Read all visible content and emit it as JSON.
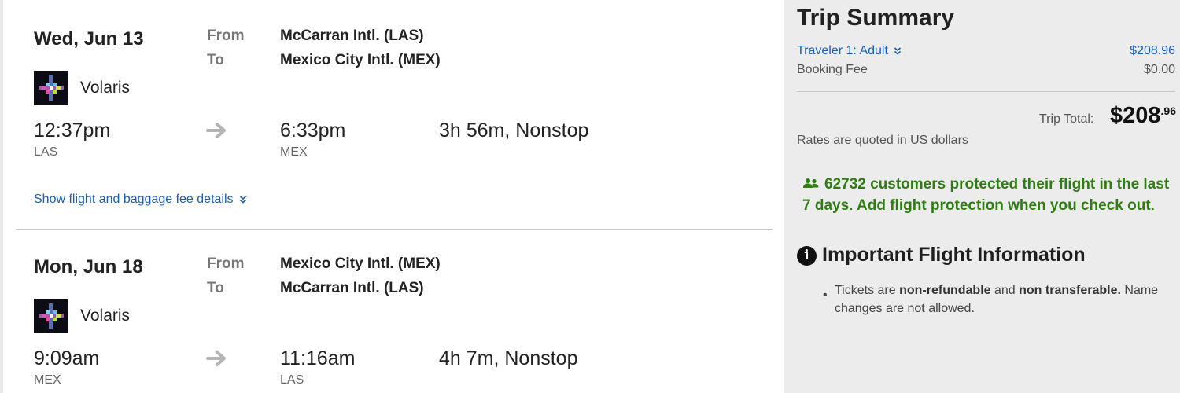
{
  "flights": [
    {
      "date": "Wed, Jun 13",
      "from_label": "From",
      "to_label": "To",
      "from_airport": "McCarran Intl. (LAS)",
      "to_airport": "Mexico City Intl. (MEX)",
      "airline": "Volaris",
      "depart_time": "12:37pm",
      "depart_code": "LAS",
      "arrive_time": "6:33pm",
      "arrive_code": "MEX",
      "duration": "3h 56m, Nonstop",
      "details_link": "Show flight and baggage fee details"
    },
    {
      "date": "Mon, Jun 18",
      "from_label": "From",
      "to_label": "To",
      "from_airport": "Mexico City Intl. (MEX)",
      "to_airport": "McCarran Intl. (LAS)",
      "airline": "Volaris",
      "depart_time": "9:09am",
      "depart_code": "MEX",
      "arrive_time": "11:16am",
      "arrive_code": "LAS",
      "duration": "4h 7m, Nonstop"
    }
  ],
  "summary": {
    "title": "Trip Summary",
    "traveler_label": "Traveler 1: Adult",
    "traveler_price": "$208.96",
    "fee_label": "Booking Fee",
    "fee_value": "$0.00",
    "total_label": "Trip Total:",
    "total_dollars": "$208",
    "total_cents": ".96",
    "rates_note": "Rates are quoted in US dollars",
    "protection_message": "62732 customers protected their flight in the last 7 days. Add flight protection when you check out."
  },
  "info": {
    "title": "Important Flight Information",
    "note_prefix": "Tickets are ",
    "note_bold_1": "non-refundable",
    "note_mid": " and ",
    "note_bold_2": "non transferable.",
    "note_suffix": " Name changes are not allowed."
  },
  "colors": {
    "link": "#1a5fb4",
    "protection_green": "#2f7d11",
    "panel_gray": "#ececec"
  },
  "icons": {
    "arrow": "right-arrow-icon",
    "chevron": "double-chevron-down-icon",
    "people": "people-icon",
    "info": "info-icon",
    "logo": "volaris-logo"
  }
}
